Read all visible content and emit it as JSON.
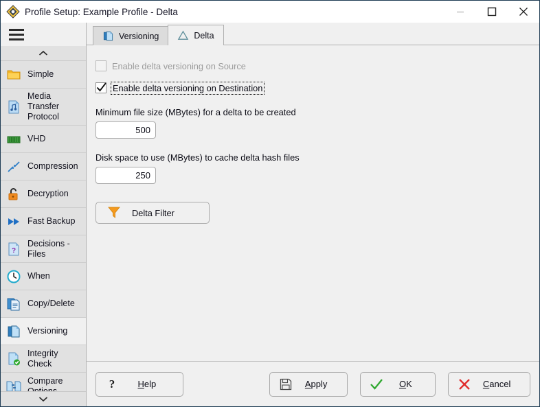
{
  "window": {
    "title": "Profile Setup: Example Profile - Delta",
    "icon": "move-sync-diamond-icon",
    "controls": {
      "minimize": "minimize-icon",
      "maximize": "maximize-icon",
      "close": "close-icon"
    }
  },
  "sidebar": {
    "menu_icon": "hamburger-icon",
    "scroll_up_icon": "chevron-up-icon",
    "scroll_down_icon": "chevron-down-icon",
    "items": [
      {
        "label": "Simple",
        "icon": "folder-icon",
        "selected": false
      },
      {
        "label": "Media Transfer Protocol",
        "icon": "music-document-icon",
        "selected": false
      },
      {
        "label": "VHD",
        "icon": "drive-icon",
        "selected": false
      },
      {
        "label": "Compression",
        "icon": "compress-arrows-icon",
        "selected": false
      },
      {
        "label": "Decryption",
        "icon": "unlock-padlock-icon",
        "selected": false
      },
      {
        "label": "Fast Backup",
        "icon": "fast-forward-icon",
        "selected": false
      },
      {
        "label": "Decisions - Files",
        "icon": "question-document-icon",
        "selected": false
      },
      {
        "label": "When",
        "icon": "clock-icon",
        "selected": false
      },
      {
        "label": "Copy/Delete",
        "icon": "copy-documents-icon",
        "selected": false
      },
      {
        "label": "Versioning",
        "icon": "versioning-pages-icon",
        "selected": true
      },
      {
        "label": "Integrity Check",
        "icon": "document-check-icon",
        "selected": false
      },
      {
        "label": "Compare Options",
        "icon": "compare-documents-icon",
        "selected": false
      }
    ]
  },
  "tabs": [
    {
      "label": "Versioning",
      "icon": "versioning-pages-icon",
      "active": false
    },
    {
      "label": "Delta",
      "icon": "delta-triangle-icon",
      "active": true
    }
  ],
  "panel": {
    "checkbox_source": {
      "label": "Enable delta versioning on Source",
      "checked": false,
      "disabled": true
    },
    "checkbox_destination": {
      "label": "Enable delta versioning on Destination",
      "checked": true,
      "disabled": false,
      "focused": true
    },
    "min_file_size": {
      "label": "Minimum file size (MBytes) for a delta to be created",
      "value": "500"
    },
    "disk_space": {
      "label": "Disk space to use (MBytes) to cache delta hash files",
      "value": "250"
    },
    "delta_filter_button": {
      "label": "Delta Filter",
      "icon": "funnel-filter-icon"
    }
  },
  "footer": {
    "help": {
      "pre": "",
      "key": "H",
      "post": "elp",
      "icon": "question-mark-icon"
    },
    "apply": {
      "pre": "",
      "key": "A",
      "post": "pply",
      "icon": "save-floppy-icon"
    },
    "ok": {
      "pre": "",
      "key": "O",
      "post": "K",
      "icon": "checkmark-icon"
    },
    "cancel": {
      "pre": "",
      "key": "C",
      "post": "ancel",
      "icon": "cross-x-icon"
    }
  },
  "colors": {
    "accent_blue": "#3a9bdc",
    "folder_yellow": "#f0b429",
    "orange": "#ef8a20",
    "green": "#2fa82f",
    "red": "#e02a2a",
    "titlebar_border": "#1c3a52"
  }
}
